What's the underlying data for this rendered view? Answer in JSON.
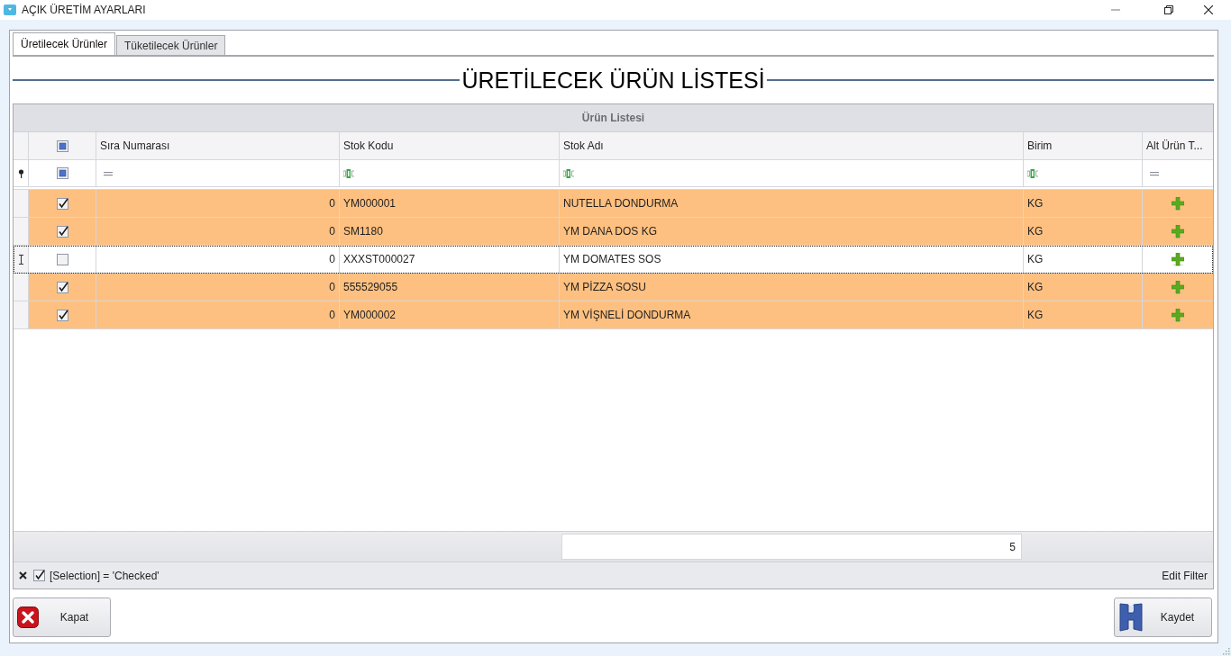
{
  "window": {
    "title": "AÇIK ÜRETİM AYARLARI"
  },
  "tabs": [
    {
      "label": "Üretilecek Ürünler",
      "selected": true
    },
    {
      "label": "Tüketilecek Ürünler",
      "selected": false
    }
  ],
  "heading": "ÜRETİLECEK ÜRÜN LİSTESİ",
  "grid": {
    "group_title": "Ürün Listesi",
    "select_all_partial": true,
    "filter_select_partial": true,
    "columns": [
      {
        "label": "Sıra Numarası",
        "kind": "number"
      },
      {
        "label": "Stok Kodu",
        "kind": "text"
      },
      {
        "label": "Stok Adı",
        "kind": "text",
        "summary": "5"
      },
      {
        "label": "Birim",
        "kind": "text"
      },
      {
        "label": "Alt Ürün T...",
        "kind": "action"
      }
    ],
    "rows": [
      {
        "checked": true,
        "focused": false,
        "cells": [
          "0",
          "YM000001",
          "NUTELLA DONDURMA",
          "KG"
        ]
      },
      {
        "checked": true,
        "focused": false,
        "cells": [
          "0",
          "SM1180",
          "YM DANA DOS KG",
          "KG"
        ]
      },
      {
        "checked": false,
        "focused": true,
        "cells": [
          "0",
          "XXXST000027",
          "YM DOMATES SOS",
          "KG"
        ]
      },
      {
        "checked": true,
        "focused": false,
        "cells": [
          "0",
          "555529055",
          "YM PİZZA SOSU",
          "KG"
        ]
      },
      {
        "checked": true,
        "focused": false,
        "cells": [
          "0",
          "YM000002",
          "YM VİŞNELİ DONDURMA",
          "KG"
        ]
      }
    ],
    "filter_bar": {
      "active": true,
      "expression": "[Selection] = 'Checked'",
      "edit_label": "Edit Filter"
    }
  },
  "buttons": [
    {
      "kind": "close",
      "label": "Kapat"
    },
    {
      "kind": "save",
      "label": "Kaydet"
    }
  ]
}
